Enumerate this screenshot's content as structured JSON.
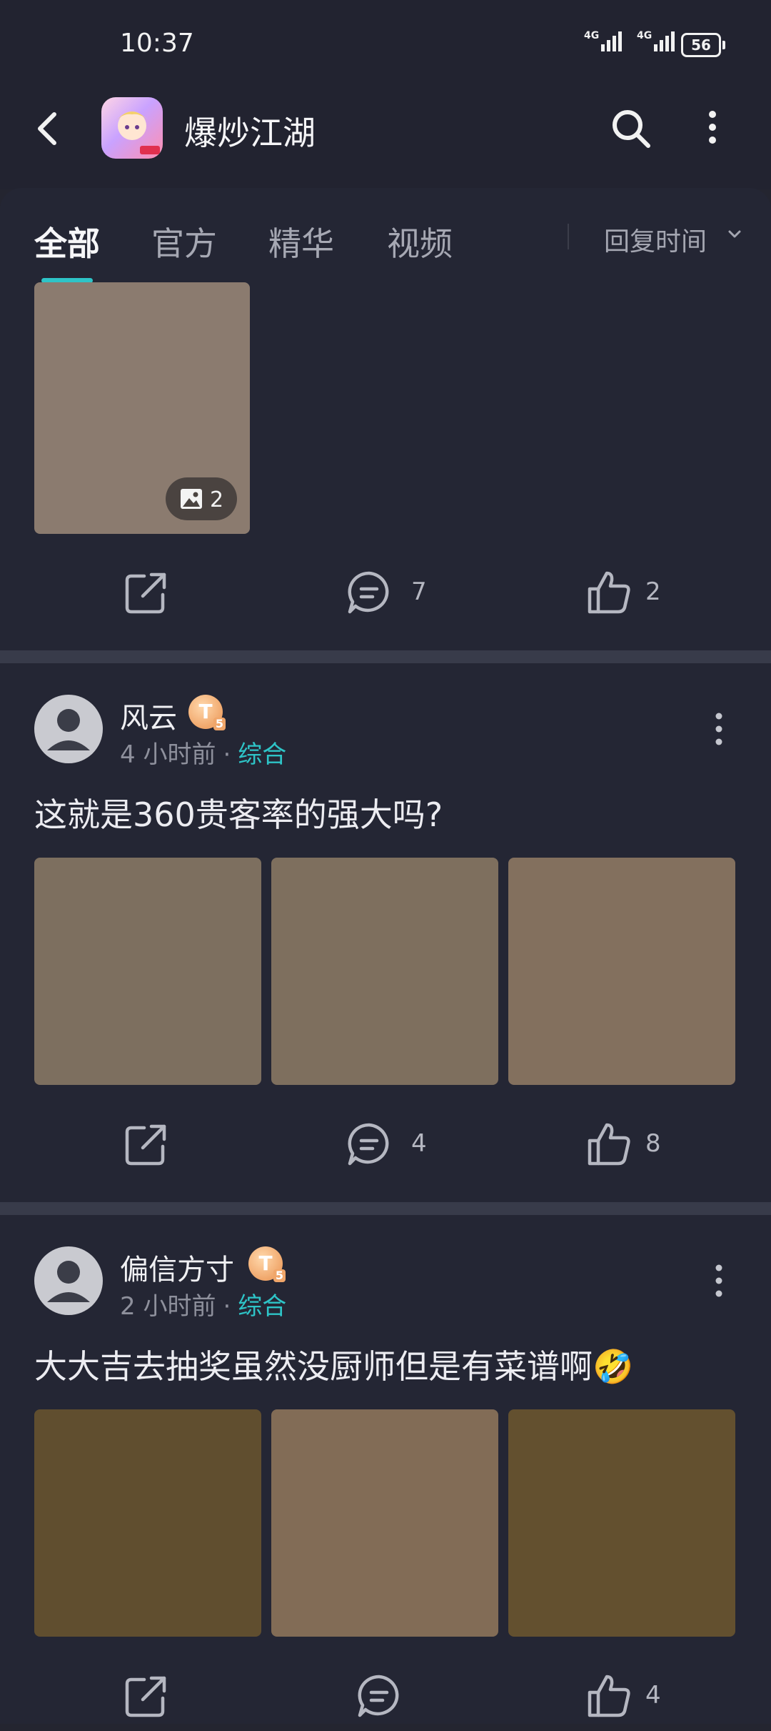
{
  "status_bar": {
    "time": "10:37",
    "battery": "56",
    "signal_label": "4G"
  },
  "app": {
    "name": "爆炒江湖"
  },
  "tabs": [
    {
      "label": "全部"
    },
    {
      "label": "官方"
    },
    {
      "label": "精华"
    },
    {
      "label": "视频"
    }
  ],
  "sort": {
    "label": "回复时间"
  },
  "post0": {
    "image_count": "2",
    "comments": "7",
    "likes": "2"
  },
  "posts": [
    {
      "author": "风云",
      "badge": "T",
      "badge_sub": "5",
      "time": "4 小时前",
      "dot": "·",
      "category": "综合",
      "text": "这就是360贵客率的强大吗?",
      "comments": "4",
      "likes": "8",
      "thumb_colors": [
        "#7d6f5f",
        "#7e6f5e",
        "#83705e"
      ]
    },
    {
      "author": "偏信方寸",
      "badge": "T",
      "badge_sub": "5",
      "time": "2 小时前",
      "dot": "·",
      "category": "综合",
      "text": "大大吉去抽奖虽然没厨师但是有菜谱啊🤣",
      "comments": "",
      "likes": "4",
      "thumb_colors": [
        "#604e2f",
        "#826c56",
        "#63502f"
      ]
    }
  ],
  "colors": {
    "accent": "#2ec4c7",
    "background": "#242530"
  }
}
